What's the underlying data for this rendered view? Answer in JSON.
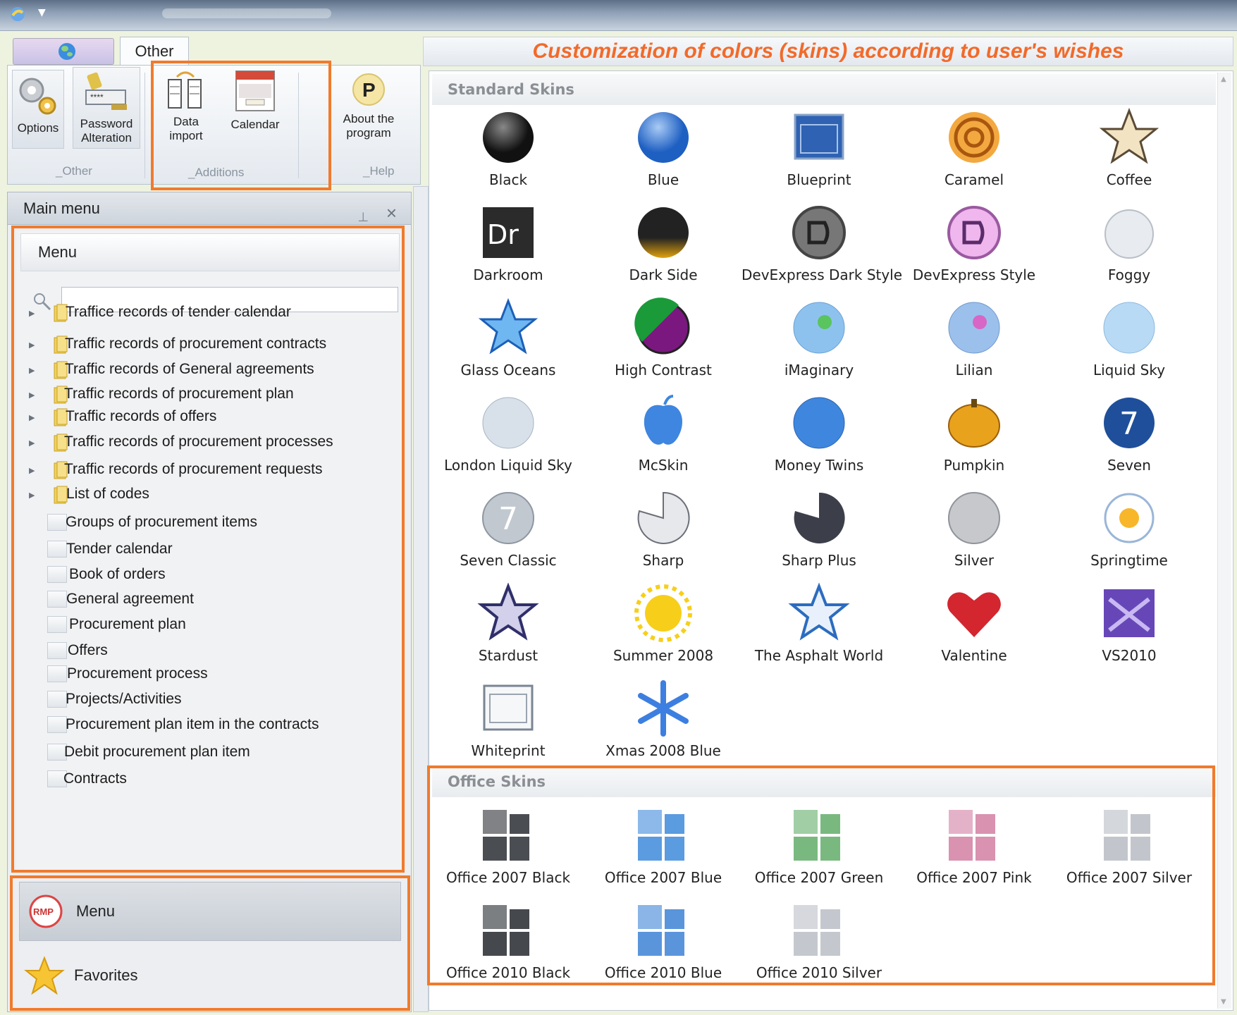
{
  "ribbon": {
    "tab_other": "Other",
    "buttons": {
      "options": "Options",
      "password_line1": "Password",
      "password_line2": "Alteration",
      "data_line1": "Data",
      "data_line2": "import",
      "calendar": "Calendar",
      "about_line1": "About the",
      "about_line2": "program"
    },
    "groups": {
      "other": "_Other",
      "additions": "_Additions",
      "help": "_Help"
    }
  },
  "headline": "Customization of colors (skins) according to user's wishes",
  "main_menu": {
    "title": "Main menu",
    "subheader": "Menu",
    "search_value": "",
    "items": [
      {
        "label": "Traffice records of tender calendar",
        "type": "folder"
      },
      {
        "label": "Traffic records of procurement contracts",
        "type": "folder"
      },
      {
        "label": "Traffic records of General agreements",
        "type": "folder"
      },
      {
        "label": "Traffic records of procurement plan",
        "type": "folder"
      },
      {
        "label": "Traffic records of offers",
        "type": "folder"
      },
      {
        "label": "Traffic records of procurement processes",
        "type": "folder"
      },
      {
        "label": "Traffic records of procurement requests",
        "type": "folder"
      },
      {
        "label": "List of codes",
        "type": "folder"
      },
      {
        "label": "Groups of procurement items",
        "type": "doc"
      },
      {
        "label": "Tender calendar",
        "type": "doc"
      },
      {
        "label": "Book of orders",
        "type": "doc"
      },
      {
        "label": "General agreement",
        "type": "doc"
      },
      {
        "label": "Procurement plan",
        "type": "doc"
      },
      {
        "label": "Offers",
        "type": "doc"
      },
      {
        "label": "Procurement process",
        "type": "doc"
      },
      {
        "label": "Projects/Activities",
        "type": "doc"
      },
      {
        "label": "Procurement plan item in the contracts",
        "type": "doc"
      },
      {
        "label": "Debit procurement plan item",
        "type": "doc"
      },
      {
        "label": "Contracts",
        "type": "doc"
      }
    ],
    "nav": {
      "menu_logo_text": "RMP",
      "menu": "Menu",
      "favorites": "Favorites"
    }
  },
  "skins": {
    "standard_title": "Standard Skins",
    "office_title": "Office Skins",
    "standard": [
      {
        "name": "Black",
        "icon": "black-sphere"
      },
      {
        "name": "Blue",
        "icon": "blue-sphere"
      },
      {
        "name": "Blueprint",
        "icon": "blueprint-frame"
      },
      {
        "name": "Caramel",
        "icon": "caramel-swirl"
      },
      {
        "name": "Coffee",
        "icon": "coffee-star"
      },
      {
        "name": "Darkroom",
        "icon": "darkroom-dr",
        "text": "Dr"
      },
      {
        "name": "Dark Side",
        "icon": "dark-side-sphere"
      },
      {
        "name": "DevExpress Dark Style",
        "icon": "devexpress-dark-logo"
      },
      {
        "name": "DevExpress Style",
        "icon": "devexpress-logo"
      },
      {
        "name": "Foggy",
        "icon": "foggy-cloud"
      },
      {
        "name": "Glass Oceans",
        "icon": "glass-oceans-star"
      },
      {
        "name": "High Contrast",
        "icon": "high-contrast-sphere"
      },
      {
        "name": "iMaginary",
        "icon": "imaginary-sphere"
      },
      {
        "name": "Lilian",
        "icon": "lilian-sphere"
      },
      {
        "name": "Liquid Sky",
        "icon": "liquid-sky-sphere"
      },
      {
        "name": "London Liquid Sky",
        "icon": "london-liquid-sky-sphere"
      },
      {
        "name": "McSkin",
        "icon": "mcskin-apple"
      },
      {
        "name": "Money Twins",
        "icon": "money-twins-sphere"
      },
      {
        "name": "Pumpkin",
        "icon": "pumpkin"
      },
      {
        "name": "Seven",
        "icon": "seven-sphere",
        "text": "7"
      },
      {
        "name": "Seven Classic",
        "icon": "seven-classic-sphere",
        "text": "7"
      },
      {
        "name": "Sharp",
        "icon": "sharp-pie"
      },
      {
        "name": "Sharp Plus",
        "icon": "sharp-plus-pie"
      },
      {
        "name": "Silver",
        "icon": "silver-sphere"
      },
      {
        "name": "Springtime",
        "icon": "springtime-flower"
      },
      {
        "name": "Stardust",
        "icon": "stardust-star"
      },
      {
        "name": "Summer 2008",
        "icon": "summer-sun"
      },
      {
        "name": "The Asphalt World",
        "icon": "asphalt-world-star"
      },
      {
        "name": "Valentine",
        "icon": "valentine-heart"
      },
      {
        "name": "VS2010",
        "icon": "vs2010-logo"
      },
      {
        "name": "Whiteprint",
        "icon": "whiteprint-frame"
      },
      {
        "name": "Xmas 2008 Blue",
        "icon": "xmas-snowflake"
      }
    ],
    "office": [
      {
        "name": "Office 2007 Black",
        "icon": "office-black-tiles",
        "color": "#4a4d52"
      },
      {
        "name": "Office 2007 Blue",
        "icon": "office-blue-tiles",
        "color": "#5b9be0"
      },
      {
        "name": "Office 2007 Green",
        "icon": "office-green-tiles",
        "color": "#79b97f"
      },
      {
        "name": "Office 2007 Pink",
        "icon": "office-pink-tiles",
        "color": "#d992b0"
      },
      {
        "name": "Office 2007 Silver",
        "icon": "office-silver-tiles",
        "color": "#c2c6cc"
      },
      {
        "name": "Office 2010 Black",
        "icon": "office-2010-black-tiles",
        "color": "#45484d"
      },
      {
        "name": "Office 2010 Blue",
        "icon": "office-2010-blue-tiles",
        "color": "#5a95dc"
      },
      {
        "name": "Office 2010 Silver",
        "icon": "office-2010-silver-tiles",
        "color": "#c4c8ce"
      }
    ]
  },
  "colors": {
    "highlight": "#f07b2d",
    "headline": "#f26a2a"
  }
}
